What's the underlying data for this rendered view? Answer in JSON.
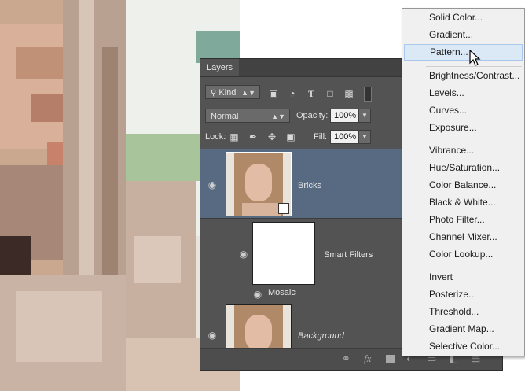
{
  "panel": {
    "tab": "Layers",
    "filter": {
      "kind_label": "Kind"
    },
    "blend_mode": "Normal",
    "opacity_label": "Opacity:",
    "opacity_value": "100%",
    "lock_label": "Lock:",
    "fill_label": "Fill:",
    "fill_value": "100%",
    "layers": [
      {
        "name": "Bricks",
        "selected": true
      },
      {
        "name": "Smart Filters"
      },
      {
        "name": "Mosaic"
      },
      {
        "name": "Background"
      }
    ]
  },
  "menu": {
    "items": [
      "Solid Color...",
      "Gradient...",
      "Pattern...",
      "Brightness/Contrast...",
      "Levels...",
      "Curves...",
      "Exposure...",
      "Vibrance...",
      "Hue/Saturation...",
      "Color Balance...",
      "Black & White...",
      "Photo Filter...",
      "Channel Mixer...",
      "Color Lookup...",
      "Invert",
      "Posterize...",
      "Threshold...",
      "Gradient Map...",
      "Selective Color..."
    ],
    "highlighted": "Pattern..."
  },
  "colors": {
    "panel_bg": "#535353",
    "selected_layer": "#576a82",
    "menu_bg": "#f0f0f0",
    "menu_highlight": "#dbe9f7"
  }
}
